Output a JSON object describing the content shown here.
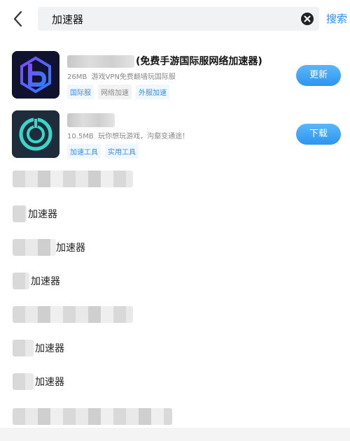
{
  "search": {
    "value": "加速器",
    "button_label": "搜索"
  },
  "apps": [
    {
      "name_suffix": "(免费手游国际服网络加速器)",
      "size": "26MB",
      "desc": "游戏VPN免费翻墙玩国际服",
      "tags": [
        "国际服",
        "网络加速",
        "外服加速"
      ],
      "action": "更新"
    },
    {
      "name_suffix": "",
      "size": "10.5MB",
      "desc": "玩你想玩游戏，沟壑变通途！",
      "tags": [
        "加速工具",
        "实用工具"
      ],
      "action": "下载"
    }
  ],
  "suggestions": [
    {
      "text": ""
    },
    {
      "text": "加速器"
    },
    {
      "text": "加速器"
    },
    {
      "text": "加速器"
    },
    {
      "text": ""
    },
    {
      "text": "加速器"
    },
    {
      "text": "加速器"
    },
    {
      "text": ""
    }
  ],
  "colors": {
    "accent": "#2b8df7",
    "button_gradient_top": "#5ab7f9",
    "button_gradient_bottom": "#2e95ef",
    "tag_text": "#3b8ee8"
  },
  "icons": {
    "back": "chevron-left-icon",
    "clear": "close-circle-icon"
  }
}
